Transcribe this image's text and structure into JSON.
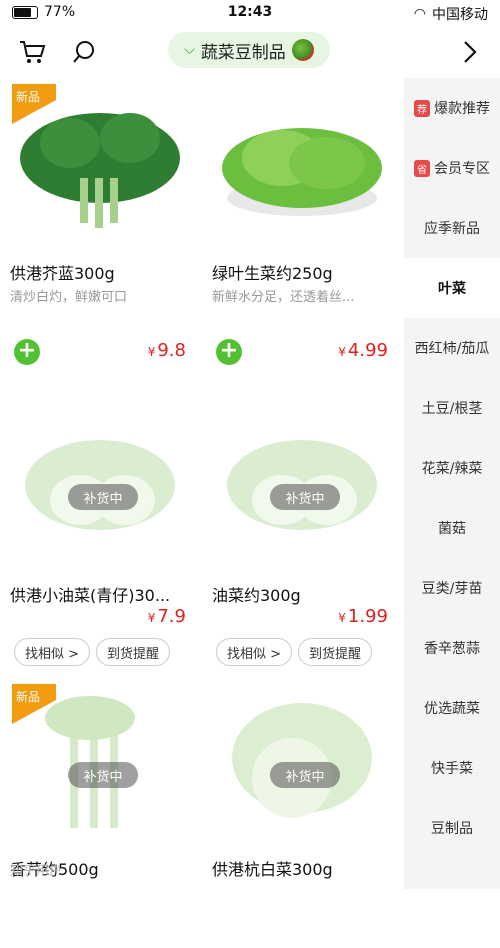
{
  "statusbar": {
    "battery": "77%",
    "time": "12:43",
    "carrier": "中国移动"
  },
  "nav": {
    "title": "蔬菜豆制品"
  },
  "sidebar": {
    "items": [
      {
        "label": "爆款推荐",
        "tag": "荐"
      },
      {
        "label": "会员专区",
        "tag": "省"
      },
      {
        "label": "应季新品",
        "tag": ""
      },
      {
        "label": "叶菜",
        "tag": ""
      },
      {
        "label": "西红柿/茄瓜",
        "tag": ""
      },
      {
        "label": "土豆/根茎",
        "tag": ""
      },
      {
        "label": "花菜/辣菜",
        "tag": ""
      },
      {
        "label": "菌菇",
        "tag": ""
      },
      {
        "label": "豆类/芽苗",
        "tag": ""
      },
      {
        "label": "香辛葱蒜",
        "tag": ""
      },
      {
        "label": "优选蔬菜",
        "tag": ""
      },
      {
        "label": "快手菜",
        "tag": ""
      },
      {
        "label": "豆制品",
        "tag": ""
      }
    ]
  },
  "products": [
    {
      "name": "供港芥蓝300g",
      "desc": "清炒白灼，鲜嫩可口",
      "currency": "¥",
      "price": "9.8",
      "badge": "新品"
    },
    {
      "name": "绿叶生菜约250g",
      "desc": "新鲜水分足，还透着丝...",
      "currency": "¥",
      "price": "4.99",
      "badge": ""
    },
    {
      "name": "供港小油菜(青仔)30...",
      "desc": "",
      "currency": "¥",
      "price": "7.9",
      "badge": "",
      "restock": "补货中"
    },
    {
      "name": "油菜约300g",
      "desc": "",
      "currency": "¥",
      "price": "1.99",
      "badge": "",
      "restock": "补货中"
    },
    {
      "name": "香芹约500g",
      "desc": "",
      "currency": "",
      "price": "",
      "badge": "新品",
      "restock": "补货中"
    },
    {
      "name": "供港杭白菜300g",
      "desc": "",
      "currency": "",
      "price": "",
      "badge": "",
      "restock": "补货中"
    }
  ],
  "actions": {
    "arrival_remind": "到货提醒",
    "find_similar": "找相似 >"
  },
  "watermark": "知乎用户"
}
